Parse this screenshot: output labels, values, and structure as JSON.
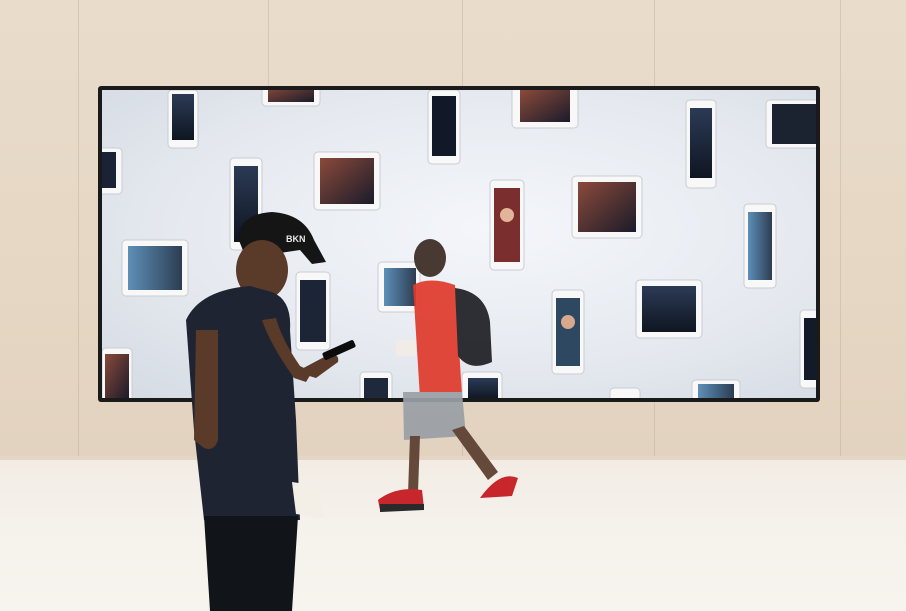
{
  "scene": {
    "description_colors": {
      "wall": "#e7d9c6",
      "floor": "#f4efe8",
      "screen_bezel": "#1a1a1a",
      "shirt_red": "#e03a2c",
      "shirt_navy": "#1f2433"
    },
    "cap_logo_text": "BKN"
  }
}
